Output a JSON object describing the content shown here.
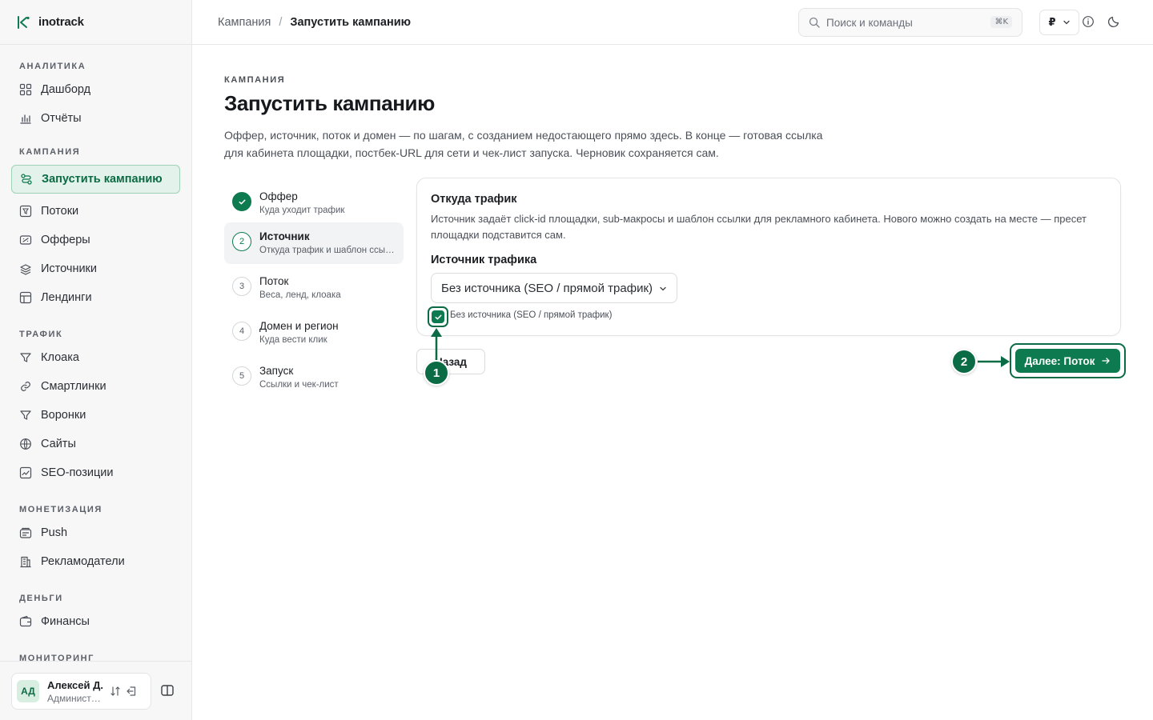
{
  "app": {
    "name": "inotrack"
  },
  "sidebar": {
    "sections": [
      {
        "title": "АНАЛИТИКА",
        "items": [
          {
            "label": "Дашборд",
            "icon": "grid-icon"
          },
          {
            "label": "Отчёты",
            "icon": "bar-chart-icon"
          }
        ]
      },
      {
        "title": "КАМПАНИЯ",
        "items": [
          {
            "label": "Запустить кампанию",
            "icon": "route-icon",
            "active": true
          },
          {
            "label": "Потоки",
            "icon": "filter-box-icon"
          },
          {
            "label": "Офферы",
            "icon": "offer-icon"
          },
          {
            "label": "Источники",
            "icon": "layers-icon"
          },
          {
            "label": "Лендинги",
            "icon": "layout-icon"
          }
        ]
      },
      {
        "title": "ТРАФИК",
        "items": [
          {
            "label": "Клоака",
            "icon": "funnel-icon"
          },
          {
            "label": "Смартлинки",
            "icon": "link-icon"
          },
          {
            "label": "Воронки",
            "icon": "funnel-icon"
          },
          {
            "label": "Сайты",
            "icon": "globe-icon"
          },
          {
            "label": "SEO-позиции",
            "icon": "trend-icon"
          }
        ]
      },
      {
        "title": "МОНЕТИЗАЦИЯ",
        "items": [
          {
            "label": "Push",
            "icon": "push-icon"
          },
          {
            "label": "Рекламодатели",
            "icon": "building-icon"
          }
        ]
      },
      {
        "title": "ДЕНЬГИ",
        "items": [
          {
            "label": "Финансы",
            "icon": "wallet-icon"
          }
        ]
      },
      {
        "title": "МОНИТОРИНГ",
        "items": []
      }
    ],
    "user": {
      "initials": "АД",
      "name": "Алексей Д.",
      "role": "Администратор"
    }
  },
  "topbar": {
    "breadcrumb": {
      "parent": "Кампания",
      "separator": "/",
      "current": "Запустить кампанию"
    },
    "search": {
      "placeholder": "Поиск и команды",
      "shortcut": "⌘K"
    },
    "currency": "₽"
  },
  "page": {
    "eyebrow": "КАМПАНИЯ",
    "title": "Запустить кампанию",
    "description": "Оффер, источник, поток и домен — по шагам, с созданием недостающего прямо здесь. В конце — готовая ссылка для кабинета площадки, постбек-URL для сети и чек-лист запуска. Черновик сохраняется сам."
  },
  "steps": [
    {
      "num": "1",
      "label": "Оффер",
      "sub": "Куда уходит трафик",
      "state": "done"
    },
    {
      "num": "2",
      "label": "Источник",
      "sub": "Откуда трафик и шаблон ссылки",
      "state": "current"
    },
    {
      "num": "3",
      "label": "Поток",
      "sub": "Веса, ленд, клоака",
      "state": "todo"
    },
    {
      "num": "4",
      "label": "Домен и регион",
      "sub": "Куда вести клик",
      "state": "todo"
    },
    {
      "num": "5",
      "label": "Запуск",
      "sub": "Ссылки и чек-лист",
      "state": "todo"
    }
  ],
  "card": {
    "title": "Откуда трафик",
    "description": "Источник задаёт click-id площадки, sub-макросы и шаблон ссылки для рекламного кабинета. Нового можно создать на месте — пресет площадки подставится сам.",
    "field_label": "Источник трафика",
    "select_value": "Без источника (SEO / прямой трафик)",
    "checkbox_label": "Без источника (SEO / прямой трафик)",
    "checkbox_checked": true
  },
  "actions": {
    "back": "Назад",
    "next": "Далее: Поток"
  },
  "annotations": [
    {
      "num": "1"
    },
    {
      "num": "2"
    }
  ],
  "colors": {
    "accent": "#0e7a4f",
    "accent_dark": "#0b6b45",
    "active_bg": "#e3f2ea"
  }
}
